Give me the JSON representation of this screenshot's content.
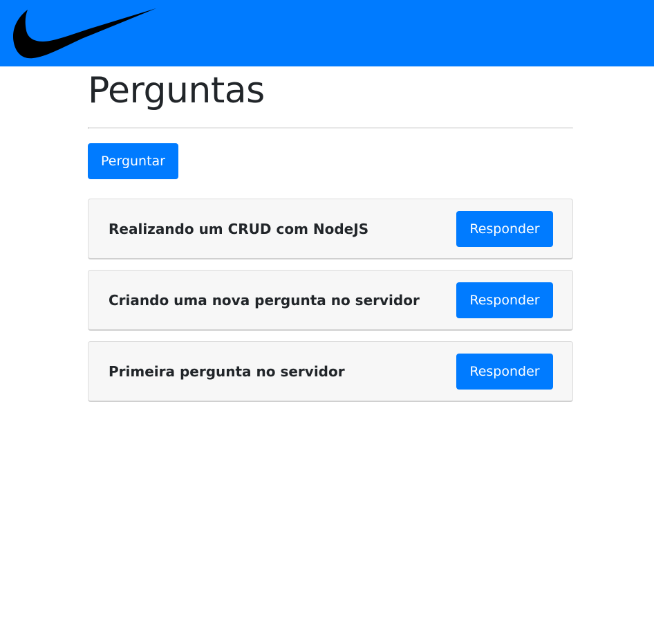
{
  "header": {
    "logo_icon": "swoosh-logo-icon",
    "background_color": "#007bff"
  },
  "page": {
    "title": "Perguntas",
    "ask_button_label": "Perguntar"
  },
  "questions": [
    {
      "title": "Realizando um CRUD com NodeJS",
      "answer_label": "Responder"
    },
    {
      "title": "Criando uma nova pergunta no servidor",
      "answer_label": "Responder"
    },
    {
      "title": "Primeira pergunta no servidor",
      "answer_label": "Responder"
    }
  ],
  "colors": {
    "primary": "#007bff",
    "card_background": "#f7f7f7",
    "text": "#212529"
  }
}
